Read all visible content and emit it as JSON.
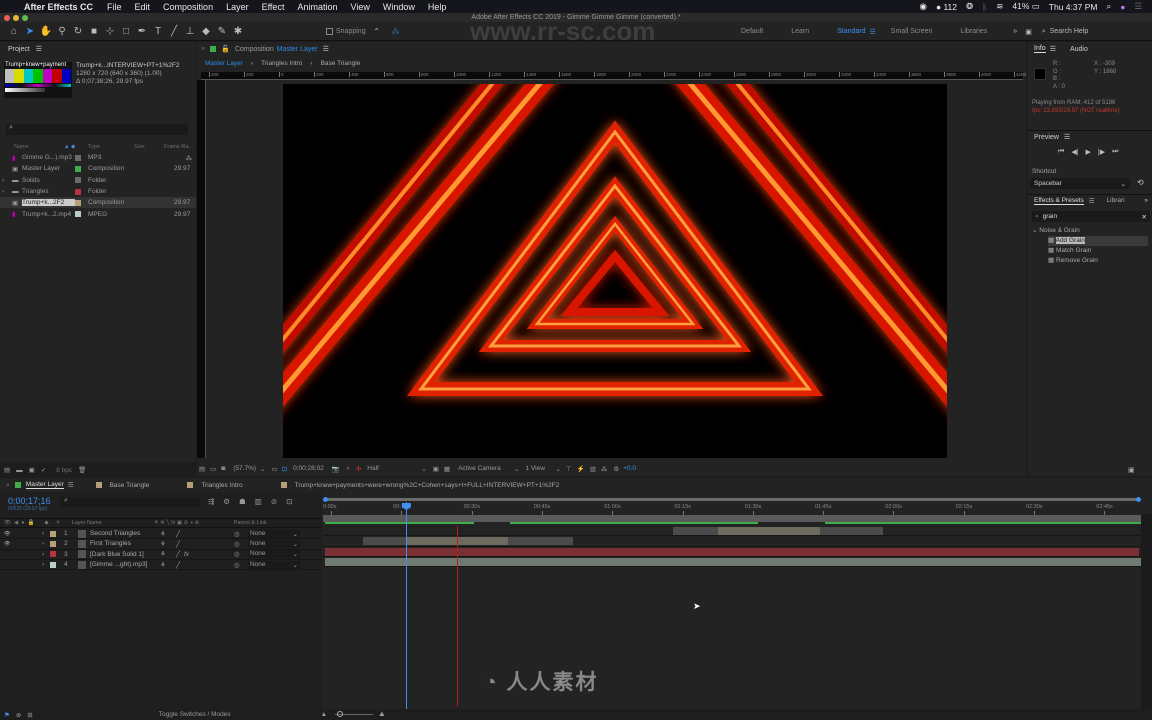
{
  "menubar": {
    "app_name": "After Effects CC",
    "items": [
      "File",
      "Edit",
      "Composition",
      "Layer",
      "Effect",
      "Animation",
      "View",
      "Window",
      "Help"
    ],
    "status": {
      "notification_count": "112",
      "battery": "41%",
      "clock": "Thu 4:37 PM"
    }
  },
  "window_title": "Adobe After Effects CC 2019 - Gimme Gimme Gimme (converted).*",
  "watermark": "www.rr-sc.com",
  "toolbar": {
    "snapping_label": "Snapping",
    "workspaces": [
      "Default",
      "Learn",
      "Standard",
      "Small Screen",
      "Libraries"
    ],
    "active_workspace": "Standard",
    "search_help_placeholder": "Search Help"
  },
  "project": {
    "title": "Project",
    "thumb_label": "Trump+knew+payment",
    "selected_name": "Trump+k...INTERVIEW+PT+1%2F2",
    "selected_dims": "1280 x 720  (640 x 360) (1.00)",
    "selected_duration": "Δ 0;07;38;26, 29.97 fps",
    "columns": [
      "Name",
      "Type",
      "Size",
      "Frame Ra..."
    ],
    "items": [
      {
        "name": "Gimme G...).mp3",
        "type": "MP3",
        "fps": "",
        "color": "#6b6b6b"
      },
      {
        "name": "Master Layer",
        "type": "Composition",
        "fps": "29.97",
        "color": "#3fae4a"
      },
      {
        "name": "Solids",
        "type": "Folder",
        "fps": "",
        "color": "#6b6b6b"
      },
      {
        "name": "Triangles",
        "type": "Folder",
        "fps": "",
        "color": "#b8323d"
      },
      {
        "name": "Trump+k...2F2",
        "type": "Composition",
        "fps": "29.97",
        "color": "#b5a07a"
      },
      {
        "name": "Trump+k...2.mp4",
        "type": "MPEG",
        "fps": "29.97",
        "color": "#b7cfc4"
      }
    ],
    "bpc": "8 bpc"
  },
  "composition": {
    "panel_title": "Composition",
    "comp_name": "Master Layer",
    "breadcrumbs": [
      "Master Layer",
      "Triangles Intro",
      "Base Triangle"
    ],
    "ruler_ticks": [
      "400",
      "200",
      "0",
      "200",
      "400",
      "600",
      "800",
      "1000",
      "1200",
      "1400",
      "1600",
      "1800",
      "2000",
      "2200",
      "2400",
      "2600",
      "2800",
      "3000",
      "3200",
      "3400",
      "3600",
      "3800",
      "4000",
      "4200"
    ],
    "zoom": "(57.7%)",
    "timecode": "0;00;28;02",
    "resolution": "Half",
    "camera": "Active Camera",
    "view": "1 View",
    "exposure": "+0.0"
  },
  "info": {
    "tabs": [
      "Info",
      "Audio"
    ],
    "r": "R :",
    "g": "G :",
    "b": "B :",
    "a": "A :  0",
    "x": "X : -309",
    "y": "Y : 1868",
    "playing": "Playing from RAM: 412 of 5186",
    "fps": "fps: 23.833/29.97 (NOT realtime)"
  },
  "preview": {
    "title": "Preview",
    "shortcut_label": "Shortcut",
    "shortcut_value": "Spacebar"
  },
  "effects": {
    "tabs": [
      "Effects & Presets",
      "Librari"
    ],
    "search_value": "grain",
    "category": "Noise & Grain",
    "items": [
      "Add Grain",
      "Match Grain",
      "Remove Grain"
    ]
  },
  "timeline": {
    "tabs": [
      {
        "label": "Master Layer",
        "color": "#3fae4a"
      },
      {
        "label": "Base Triangle",
        "color": "#b5a07a"
      },
      {
        "label": "Triangles Intro",
        "color": "#b5a07a"
      },
      {
        "label": "Trump+knew+payments+were+wrong%2C+Cohen+says+I+FULL+INTERVIEW+PT+1%2F2",
        "color": "#b5a07a"
      }
    ],
    "current_time": "0;00;17;16",
    "frame_info": "00526 (29.97 fps)",
    "col_headers": {
      "num": "#",
      "layer_name": "Layer Name",
      "parent": "Parent & Link"
    },
    "ticks": [
      "0:00s",
      "00:15s",
      "00:30s",
      "00:45s",
      "01:00s",
      "01:15s",
      "01:30s",
      "01:45s",
      "02:00s",
      "02:15s",
      "02:30s",
      "02:45s"
    ],
    "layers": [
      {
        "num": "1",
        "name": "Second Triangles",
        "color": "#b5a07a",
        "parent": "None",
        "fx": ""
      },
      {
        "num": "2",
        "name": "First Triangles",
        "color": "#b5a07a",
        "parent": "None",
        "fx": ""
      },
      {
        "num": "3",
        "name": "[Dark Blue Solid 1]",
        "color": "#b8323d",
        "parent": "None",
        "fx": "fx"
      },
      {
        "num": "4",
        "name": "[Gimme ...ght).mp3]",
        "color": "#b7cfc4",
        "parent": "None",
        "fx": ""
      }
    ],
    "toggle_label": "Toggle Switches / Modes"
  }
}
